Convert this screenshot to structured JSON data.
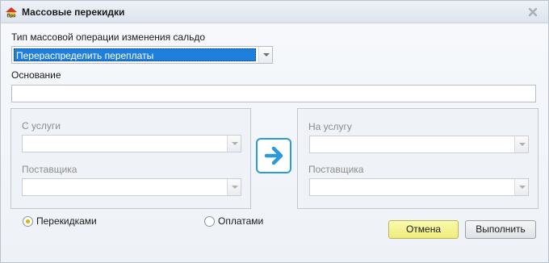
{
  "window": {
    "title": "Массовые перекидки",
    "app_icon_text": "Про"
  },
  "form": {
    "operation_type_label": "Тип массовой операции изменения сальдо",
    "operation_type_value": "Перераспределить переплаты",
    "basis_label": "Основание",
    "basis_value": ""
  },
  "from": {
    "service_label": "С услуги",
    "service_value": "",
    "supplier_label": "Поставщика",
    "supplier_value": ""
  },
  "to": {
    "service_label": "На услугу",
    "service_value": "",
    "supplier_label": "Поставщика",
    "supplier_value": ""
  },
  "mode": {
    "options": [
      "Перекидками",
      "Оплатами"
    ],
    "selected": "Перекидками"
  },
  "buttons": {
    "cancel": "Отмена",
    "execute": "Выполнить"
  },
  "colors": {
    "accent": "#1f7fdc",
    "arrow": "#2a9ad8",
    "cancel_bg": "#f4f19a",
    "radio_checked": "#d6b800"
  },
  "icons": {
    "app": "house-icon",
    "close": "close-icon",
    "transfer": "arrow-right-icon"
  }
}
